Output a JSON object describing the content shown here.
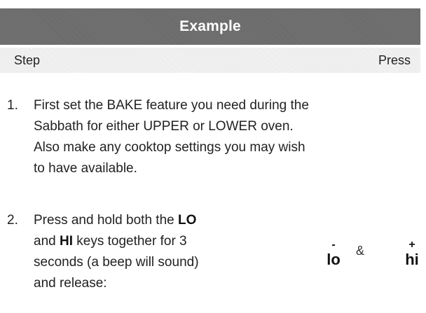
{
  "header": {
    "title": "Example"
  },
  "subheader": {
    "left": "Step",
    "right": "Press"
  },
  "steps": [
    {
      "number": "1.",
      "lines": [
        "First set the BAKE feature you need during the",
        "Sabbath for either UPPER or LOWER oven.",
        "Also make any cooktop settings you may wish",
        "to have available."
      ]
    },
    {
      "number": "2.",
      "lines": [
        "and release:"
      ],
      "line1_before": "Press and hold both the ",
      "line1_bold": "LO",
      "line2_bold": "HI",
      "line2_after": " keys together for 3",
      "line3": "seconds (a beep will sound)"
    }
  ],
  "keys": {
    "lo_symbol": "-",
    "lo_label": "lo",
    "separator": "&",
    "hi_symbol": "+",
    "hi_label": "hi"
  }
}
